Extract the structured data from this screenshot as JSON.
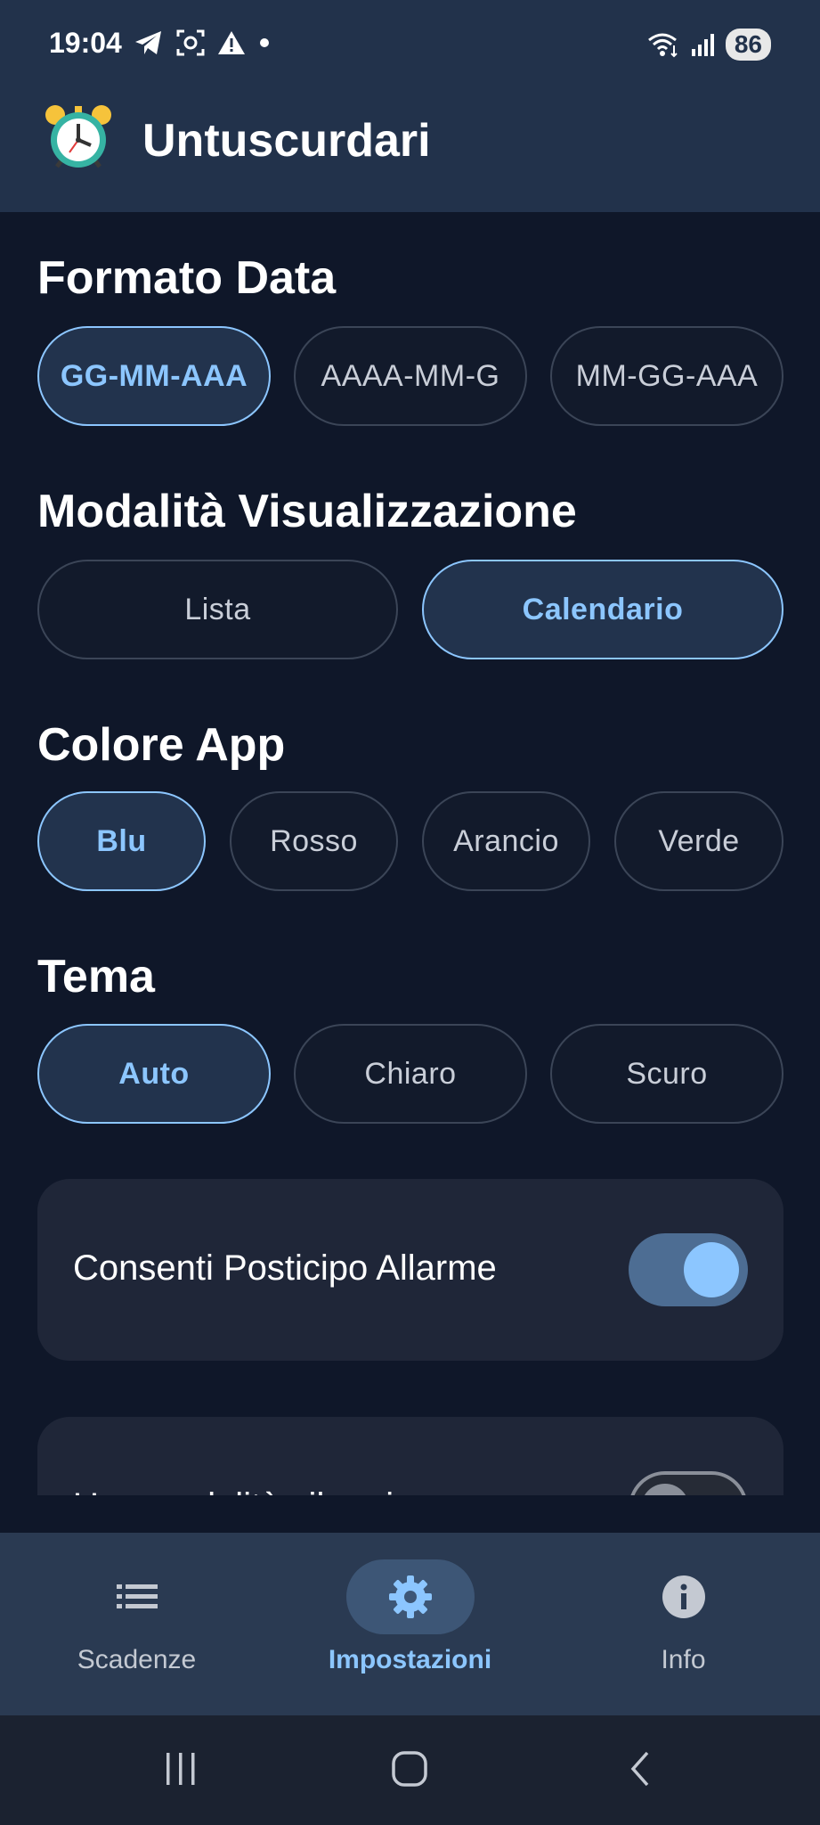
{
  "status_bar": {
    "time": "19:04",
    "left_icons": [
      "telegram-icon",
      "screenshot-icon",
      "warning-icon",
      "dot-icon"
    ],
    "right_icons": [
      "wifi-icon",
      "signal-icon"
    ],
    "battery": "86"
  },
  "app_bar": {
    "icon": "alarm-clock-icon",
    "title": "Untuscurdari"
  },
  "sections": {
    "date_format": {
      "title": "Formato Data",
      "options": [
        "GG-MM-AAA",
        "AAAA-MM-G",
        "MM-GG-AAA"
      ],
      "selected": "GG-MM-AAA"
    },
    "view_mode": {
      "title": "Modalità Visualizzazione",
      "options": [
        "Lista",
        "Calendario"
      ],
      "selected": "Calendario"
    },
    "app_color": {
      "title": "Colore App",
      "options": [
        "Blu",
        "Rosso",
        "Arancio",
        "Verde"
      ],
      "selected": "Blu"
    },
    "theme": {
      "title": "Tema",
      "options": [
        "Auto",
        "Chiaro",
        "Scuro"
      ],
      "selected": "Auto"
    }
  },
  "toggles": [
    {
      "label": "Consenti Posticipo Allarme",
      "on": true
    },
    {
      "label": "Usa modalità vibrazione",
      "on": false
    }
  ],
  "bottom_nav": {
    "items": [
      {
        "label": "Scadenze",
        "icon": "list-icon",
        "active": false
      },
      {
        "label": "Impostazioni",
        "icon": "gear-icon",
        "active": true
      },
      {
        "label": "Info",
        "icon": "info-icon",
        "active": false
      }
    ]
  },
  "system_nav": [
    "recents-icon",
    "home-icon",
    "back-icon"
  ],
  "colors": {
    "accent": "#8cc6ff",
    "background": "#0f1729",
    "bar": "#22324b",
    "card": "#1f2638"
  }
}
